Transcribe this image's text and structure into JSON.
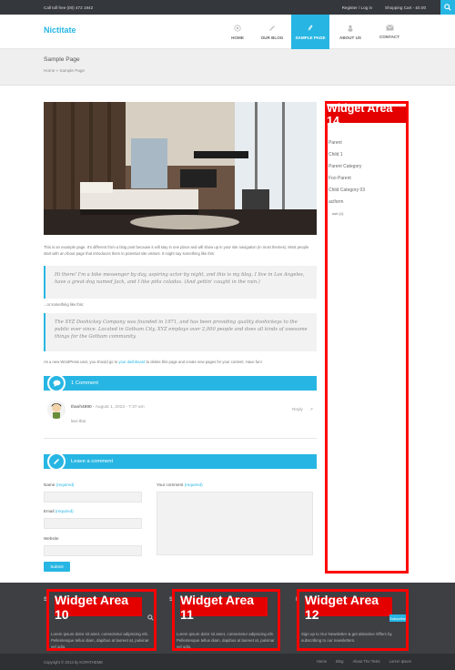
{
  "topbar": {
    "phone": "Call toll free (00) 472 1942",
    "register": "Register / Log in",
    "cart": "Shopping Cart - £0.00"
  },
  "header": {
    "logo": "Nictitate"
  },
  "nav": {
    "items": [
      {
        "label": "HOME",
        "icon": "home-icon",
        "active": false
      },
      {
        "label": "OUR BLOG",
        "icon": "pencil-icon",
        "active": false
      },
      {
        "label": "SAMPLE PAGE",
        "icon": "paperclip-icon",
        "active": true
      },
      {
        "label": "ABOUT US",
        "icon": "person-icon",
        "active": false
      },
      {
        "label": "CONTACT",
        "icon": "mail-icon",
        "active": false
      }
    ]
  },
  "page": {
    "title": "Sample Page",
    "breadcrumb_home": "Home",
    "breadcrumb_sep": "»",
    "breadcrumb_current": "Sample Page"
  },
  "content": {
    "intro": "This is an example page. It's different from a blog post because it will stay in one place and will show up in your site navigation (in most themes). Most people start with an About page that introduces them to potential site visitors. It might say something like this:",
    "quote1": "Hi there! I'm a bike messenger by day, aspiring actor by night, and this is my blog. I live in Los Angeles, have a great dog named Jack, and I like piña coladas. (And gettin' caught in the rain.)",
    "or_text": "...or something like this:",
    "quote2": "The XYZ Doohickey Company was founded in 1971, and has been providing quality doohickeys to the public ever since. Located in Gotham City, XYZ employs over 2,000 people and does all kinds of awesome things for the Gotham community.",
    "outro_start": "As a new WordPress user, you should go to",
    "outro_link": "your dashboard",
    "outro_end": "to delete this page and create new pages for your content. Have fun!"
  },
  "comments": {
    "heading": "1 Comment",
    "author": "thanh4890",
    "date": "- August 1, 2013 - 7:37 am",
    "reply": "Reply",
    "text": "love that"
  },
  "leave_comment": {
    "heading": "Leave a comment",
    "name_label": "Name",
    "email_label": "Email",
    "website_label": "Website",
    "comment_label": "Your comment",
    "required": "(required)",
    "submit": "Submit"
  },
  "sidebar": {
    "widget_label": "Widget Area 14",
    "items": [
      "Parent",
      "Child 1",
      "Parent Category",
      "Foo Parent",
      "Child Category 03",
      "aciform"
    ],
    "sub_item": "sub (1)"
  },
  "footer": {
    "widgets": [
      {
        "label": "Widget Area 10",
        "text": "Lorem ipsum dolor sit amet, consectetur adipiscing elit. Pellentesque tellus diam, dapibus at laoreet at, pulvinar vel odio."
      },
      {
        "label": "Widget Area 11",
        "text": "Lorem ipsum dolor sit amet, consectetur adipiscing elit. Pellentesque tellus diam, dapibus at laoreet at, pulvinar vel odio."
      },
      {
        "label": "Widget Area 12",
        "text": "Sign up to Our Newsletter & get attractive Offers by subscribing to our newsletters."
      }
    ],
    "subscribe": "Subscribe"
  },
  "bottombar": {
    "copyright": "Copyright © 2013 by KOPATHEME",
    "links": [
      "Home",
      "Blog",
      "About The Tests",
      "Lorem Ipsum"
    ]
  },
  "colors": {
    "accent": "#27b6e3",
    "widget_red": "#e50000",
    "footer_bg": "#3d3f43"
  }
}
